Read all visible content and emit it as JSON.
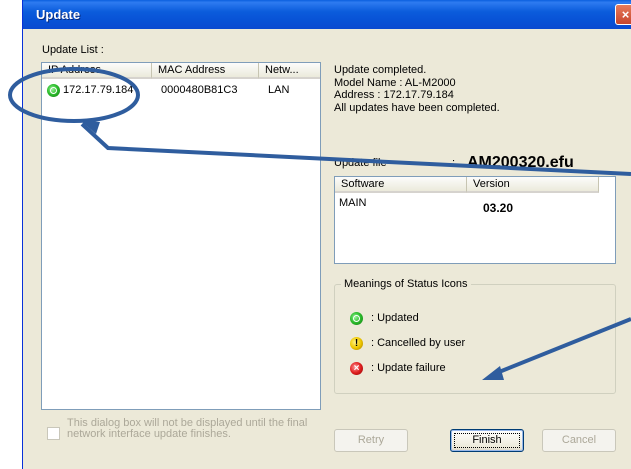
{
  "window": {
    "title": "Update",
    "close_glyph": "×"
  },
  "update_list": {
    "label": "Update List :",
    "columns": [
      "IP Address",
      "MAC Address",
      "Netw..."
    ],
    "rows": [
      {
        "status_icon": "updated-icon",
        "ip": "172.17.79.184",
        "mac": "0000480B81C3",
        "network": "LAN"
      }
    ]
  },
  "status_message": {
    "lines": [
      "Update completed.",
      "Model Name : AL-M2000",
      "Address : 172.17.79.184",
      "All updates have been completed."
    ]
  },
  "update_file": {
    "label": "Update file",
    "separator": ":",
    "filename": "AM200320.efu",
    "columns": [
      "Software",
      "Version"
    ],
    "rows": [
      {
        "software": "MAIN",
        "version": "03.20"
      }
    ]
  },
  "legend": {
    "title": "Meanings of Status Icons",
    "items": [
      {
        "icon": "updated-icon",
        "label": ": Updated"
      },
      {
        "icon": "cancelled-icon",
        "label": ": Cancelled by user"
      },
      {
        "icon": "failure-icon",
        "label": ": Update failure"
      }
    ]
  },
  "checkbox": {
    "line1": "This dialog box will not be displayed until the final",
    "line2": "network interface update finishes.",
    "checked": false
  },
  "buttons": {
    "retry": "Retry",
    "finish": "Finish",
    "cancel": "Cancel"
  },
  "colors": {
    "annotation": "#2f5d9e",
    "titlebar": "#0a52d6"
  }
}
